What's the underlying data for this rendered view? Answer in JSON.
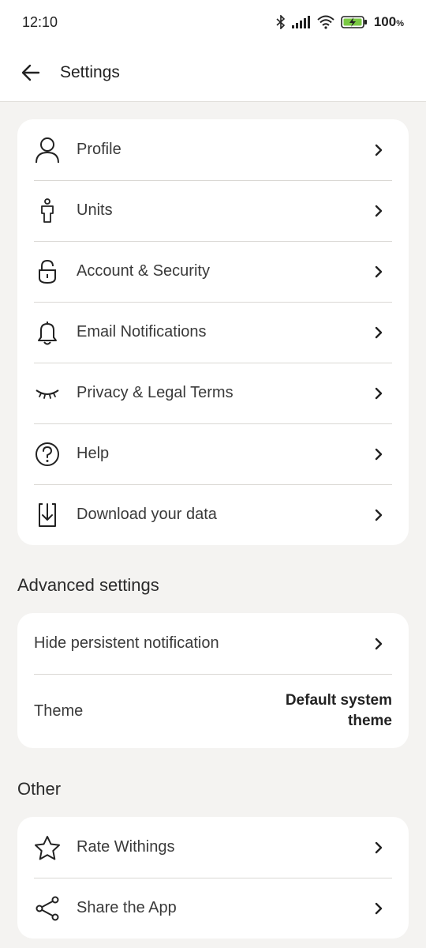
{
  "status_bar": {
    "time": "12:10",
    "battery_percent": "100",
    "battery_unit": "%"
  },
  "header": {
    "title": "Settings"
  },
  "main_menu": [
    {
      "label": "Profile",
      "icon": "person-icon"
    },
    {
      "label": "Units",
      "icon": "figure-icon"
    },
    {
      "label": "Account & Security",
      "icon": "padlock-icon"
    },
    {
      "label": "Email Notifications",
      "icon": "bell-icon"
    },
    {
      "label": "Privacy & Legal Terms",
      "icon": "closed-eye-icon"
    },
    {
      "label": "Help",
      "icon": "help-circle-icon"
    },
    {
      "label": "Download your data",
      "icon": "download-icon"
    }
  ],
  "advanced": {
    "title": "Advanced settings",
    "items": [
      {
        "label": "Hide persistent notification"
      },
      {
        "label": "Theme",
        "value_line1": "Default system",
        "value_line2": "theme"
      }
    ]
  },
  "other": {
    "title": "Other",
    "items": [
      {
        "label": "Rate Withings",
        "icon": "star-icon"
      },
      {
        "label": "Share the App",
        "icon": "share-icon"
      }
    ]
  },
  "colors": {
    "page_background": "#f4f3f1",
    "card_background": "#ffffff",
    "divider": "#dad8d4",
    "text": "#2b2b2b"
  }
}
